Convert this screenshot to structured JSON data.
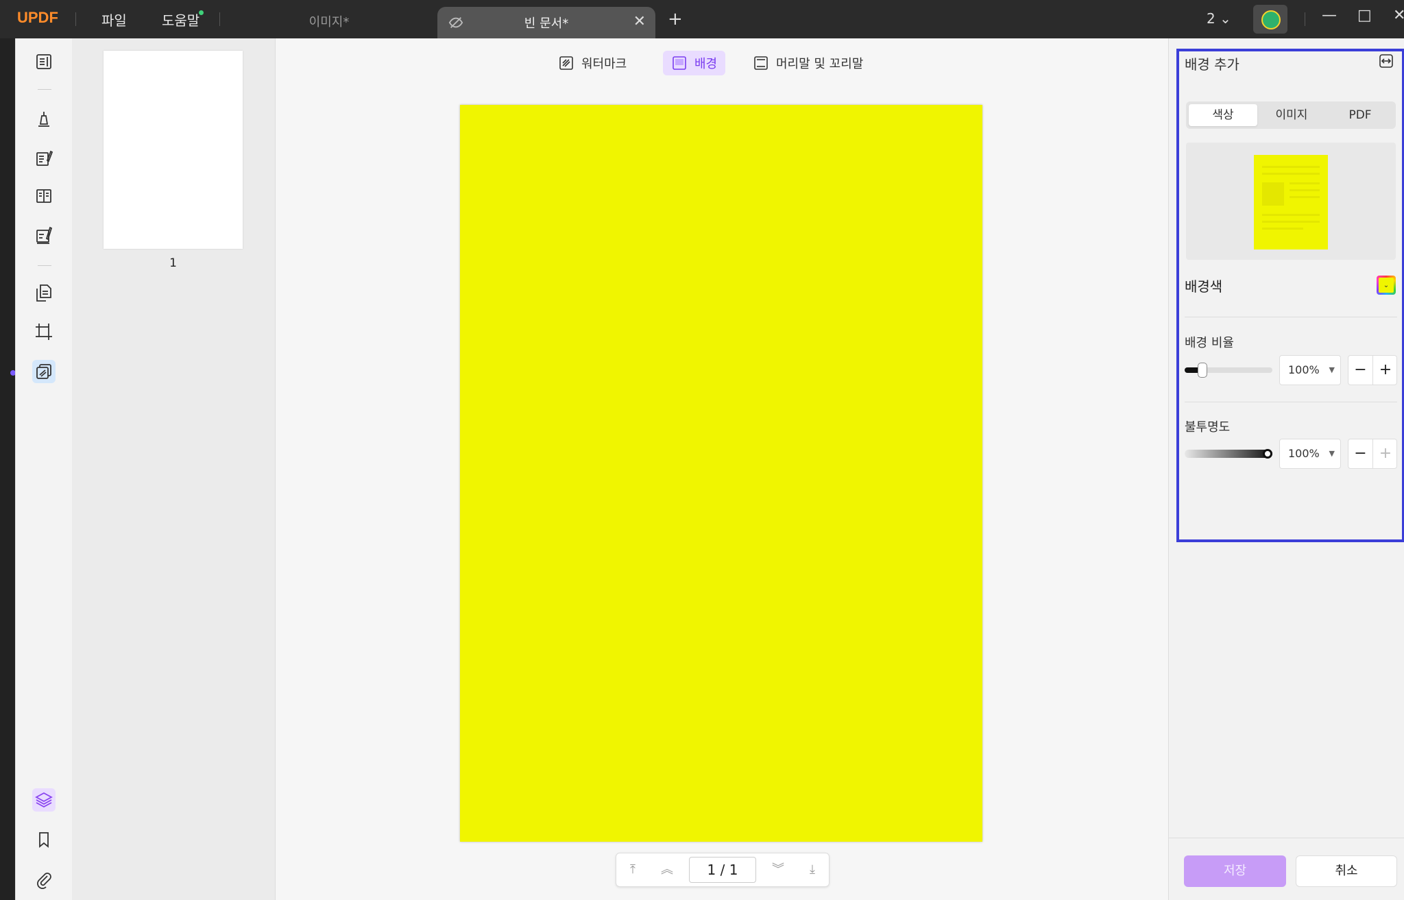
{
  "app": {
    "logo": "UPDF",
    "menu": {
      "file": "파일",
      "help": "도움말"
    },
    "tabs": [
      {
        "title": "이미지*",
        "active": false
      },
      {
        "title": "빈 문서*",
        "active": true
      }
    ],
    "page_count": "2",
    "window_controls": {
      "minimize": "—",
      "maximize": "□",
      "close": "✕"
    }
  },
  "left_toolbar": {
    "tools": [
      "reader-icon",
      "comment-icon",
      "edit-pdf-icon",
      "organize-icon",
      "fill-sign-icon",
      "convert-icon",
      "crop-icon",
      "page-tools-icon"
    ],
    "active": "page-tools-icon",
    "bottom": [
      "layers-icon",
      "bookmark-icon",
      "attachment-icon"
    ]
  },
  "thumbnails": {
    "items": [
      {
        "label": "1"
      }
    ]
  },
  "main": {
    "top_buttons": {
      "watermark": "워터마크",
      "background": "배경",
      "header_footer": "머리말 및 꼬리말"
    },
    "active_button": "background",
    "page_color": "#f0f500",
    "pager": {
      "current": "1 / 1"
    }
  },
  "right_panel": {
    "title": "배경 추가",
    "segments": {
      "color": "색상",
      "image": "이미지",
      "pdf": "PDF"
    },
    "active_segment": "color",
    "background_color_label": "배경색",
    "background_color": "#f0f500",
    "ratio": {
      "label": "배경 비율",
      "value": "100%",
      "fill": 0.2
    },
    "opacity": {
      "label": "불투명도",
      "value": "100%",
      "fill": 1.0
    },
    "save_label": "저장",
    "cancel_label": "취소"
  }
}
